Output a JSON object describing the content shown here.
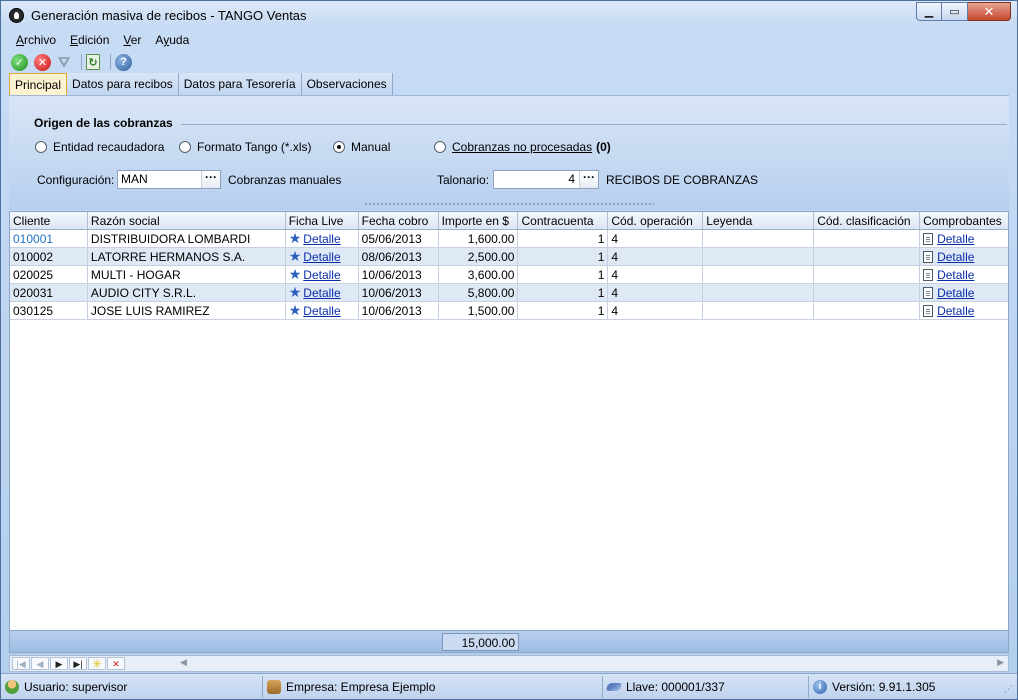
{
  "window": {
    "title": "Generación masiva de recibos - TANGO Ventas",
    "min_glyph": "▁",
    "max_glyph": "▭",
    "close_glyph": "✕"
  },
  "menu": [
    {
      "label": "Archivo",
      "accel": "A",
      "rest": "rchivo"
    },
    {
      "label": "Edición",
      "accel": "E",
      "rest": "dición"
    },
    {
      "label": "Ver",
      "accel": "V",
      "rest": "er"
    },
    {
      "label": "Ayuda",
      "accel": "y",
      "rest": "uda",
      "pre": "A"
    }
  ],
  "toolbar": {
    "ok_icon": "check-icon",
    "cancel_icon": "cancel-icon",
    "filter_icon": "filter-icon",
    "refresh_icon": "refresh-icon",
    "help_icon": "help-icon",
    "ok_glyph": "✓",
    "cancel_glyph": "✕",
    "filter_glyph": "⛛",
    "refresh_glyph": "↻",
    "help_glyph": "?"
  },
  "tabs": [
    {
      "label": "Principal",
      "active": true
    },
    {
      "label": "Datos para recibos",
      "active": false
    },
    {
      "label": "Datos para Tesorería",
      "active": false
    },
    {
      "label": "Observaciones",
      "active": false
    }
  ],
  "origen": {
    "title": "Origen de las cobranzas",
    "options": [
      {
        "label": "Entidad recaudadora",
        "selected": false
      },
      {
        "label": "Formato Tango (*.xls)",
        "selected": false
      },
      {
        "label": "Manual",
        "selected": true
      },
      {
        "label": "Cobranzas no procesadas",
        "count": "(0)",
        "selected": false
      }
    ]
  },
  "config": {
    "label": "Configuración:",
    "value": "MAN",
    "description": "Cobranzas manuales",
    "ellipsis": "···"
  },
  "talonario": {
    "label": "Talonario:",
    "value": "4",
    "description": "RECIBOS DE COBRANZAS",
    "ellipsis": "···"
  },
  "grid": {
    "columns": [
      "Cliente",
      "Razón social",
      "Ficha Live",
      "Fecha cobro",
      "Importe en $",
      "Contracuenta",
      "Cód. operación",
      "Leyenda",
      "Cód. clasificación",
      "Comprobantes"
    ],
    "rows": [
      {
        "cliente": "010001",
        "razon": "DISTRIBUIDORA LOMBARDI",
        "ficha": "Detalle",
        "fecha": "05/06/2013",
        "importe": "1,600.00",
        "contracuenta": "1",
        "operacion": "4",
        "leyenda": "",
        "clasificacion": "",
        "comprobantes": "Detalle"
      },
      {
        "cliente": "010002",
        "razon": "LATORRE HERMANOS S.A.",
        "ficha": "Detalle",
        "fecha": "08/06/2013",
        "importe": "2,500.00",
        "contracuenta": "1",
        "operacion": "4",
        "leyenda": "",
        "clasificacion": "",
        "comprobantes": "Detalle"
      },
      {
        "cliente": "020025",
        "razon": "MULTI - HOGAR",
        "ficha": "Detalle",
        "fecha": "10/06/2013",
        "importe": "3,600.00",
        "contracuenta": "1",
        "operacion": "4",
        "leyenda": "",
        "clasificacion": "",
        "comprobantes": "Detalle"
      },
      {
        "cliente": "020031",
        "razon": "AUDIO CITY S.R.L.",
        "ficha": "Detalle",
        "fecha": "10/06/2013",
        "importe": "5,800.00",
        "contracuenta": "1",
        "operacion": "4",
        "leyenda": "",
        "clasificacion": "",
        "comprobantes": "Detalle"
      },
      {
        "cliente": "030125",
        "razon": "JOSE LUIS RAMIREZ",
        "ficha": "Detalle",
        "fecha": "10/06/2013",
        "importe": "1,500.00",
        "contracuenta": "1",
        "operacion": "4",
        "leyenda": "",
        "clasificacion": "",
        "comprobantes": "Detalle"
      }
    ],
    "total": "15,000.00"
  },
  "navigator": {
    "first": "|◀",
    "prev": "◀",
    "next": "▶",
    "last": "▶|",
    "add": "✳",
    "delete": "✕",
    "scroll_left": "◀",
    "scroll_right": "▶"
  },
  "status": {
    "usuario": "Usuario: supervisor",
    "empresa": "Empresa: Empresa Ejemplo",
    "llave": "Llave: 000001/337",
    "version": "Versión: 9.91.1.305",
    "info_glyph": "i",
    "grip_glyph": "⋰"
  }
}
